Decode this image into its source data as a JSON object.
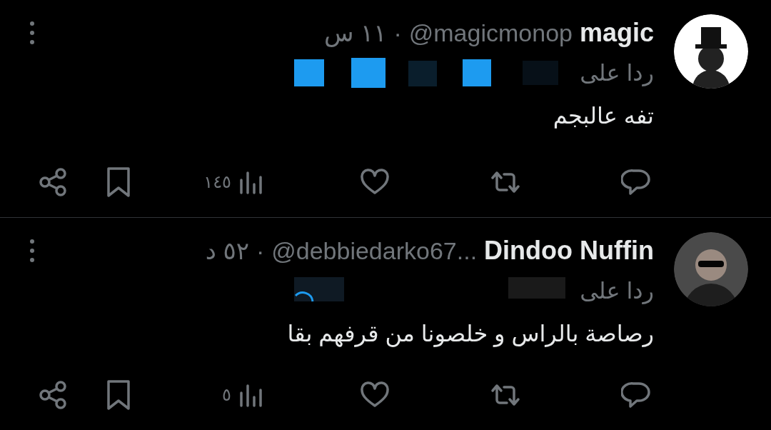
{
  "tweets": [
    {
      "name": "magic",
      "handle": "@magicmonop",
      "separator": "·",
      "time": "١١ س",
      "reply_prefix": "ردا على",
      "text": "تفه عالبجم",
      "views": "١٤٥",
      "kind": "hat"
    },
    {
      "name": "Dindoo Nuffin",
      "handle": "@debbiedarko67...",
      "separator": "·",
      "time": "٥٢ د",
      "reply_prefix": "ردا على",
      "text": "رصاصة بالراس و خلصونا من قرفهم بقا",
      "views": "٥",
      "kind": "glasses"
    }
  ]
}
